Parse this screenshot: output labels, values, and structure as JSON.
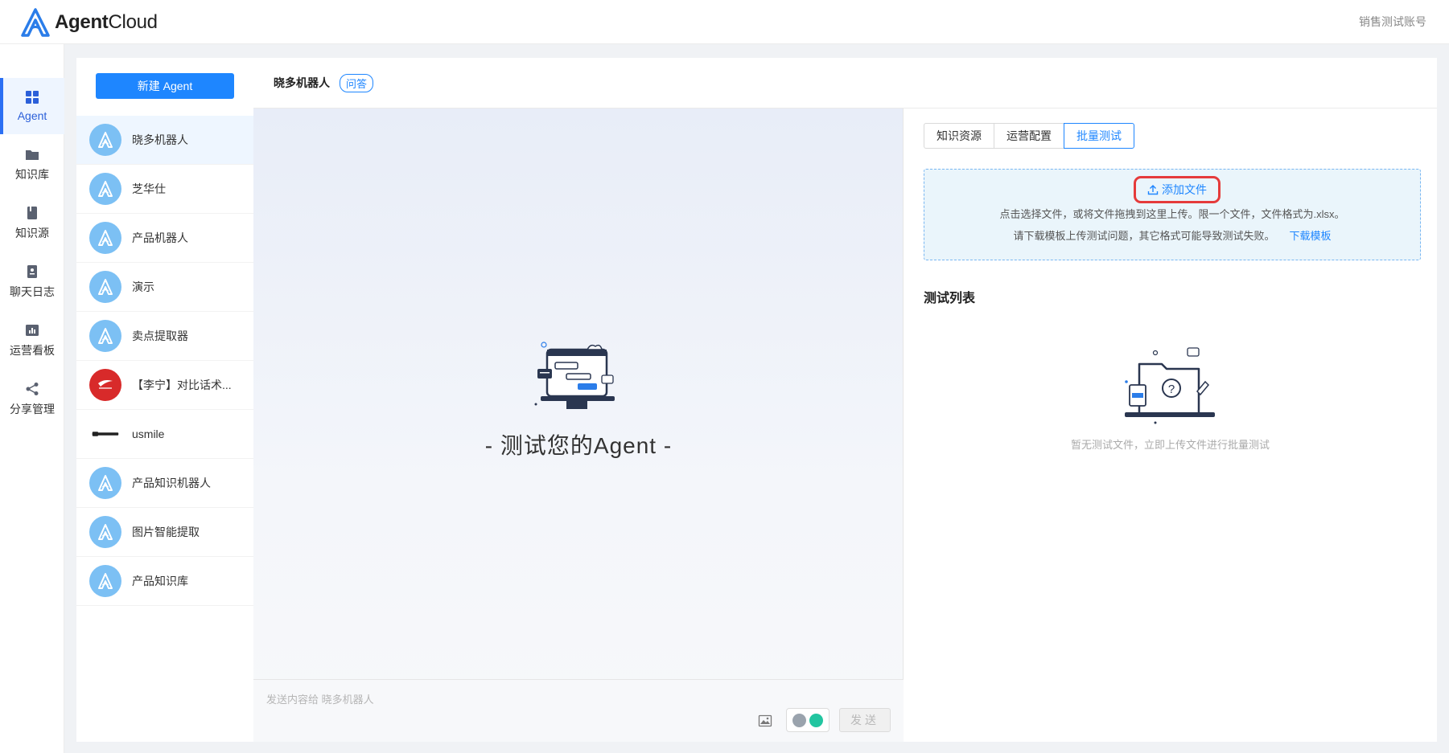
{
  "app": {
    "logo_text_bold": "Agent",
    "logo_text_light": "Cloud",
    "account": "销售测试账号"
  },
  "nav": [
    {
      "label": "Agent",
      "icon": "grid-icon",
      "active": true
    },
    {
      "label": "知识库",
      "icon": "folder-icon"
    },
    {
      "label": "知识源",
      "icon": "book-icon"
    },
    {
      "label": "聊天日志",
      "icon": "log-icon"
    },
    {
      "label": "运营看板",
      "icon": "chart-icon"
    },
    {
      "label": "分享管理",
      "icon": "share-icon"
    }
  ],
  "agent_panel": {
    "new_button": "新建 Agent",
    "agents": [
      {
        "name": "晓多机器人",
        "avatar": "agent-icon",
        "active": true
      },
      {
        "name": "芝华仕",
        "avatar": "agent-icon"
      },
      {
        "name": "产品机器人",
        "avatar": "agent-icon"
      },
      {
        "name": "演示",
        "avatar": "agent-icon"
      },
      {
        "name": "卖点提取器",
        "avatar": "agent-icon"
      },
      {
        "name": "【李宁】对比话术...",
        "avatar": "li-ning-logo"
      },
      {
        "name": "usmile",
        "avatar": "usmile-logo"
      },
      {
        "name": "产品知识机器人",
        "avatar": "agent-icon"
      },
      {
        "name": "图片智能提取",
        "avatar": "agent-icon"
      },
      {
        "name": "产品知识库",
        "avatar": "agent-icon"
      }
    ]
  },
  "header": {
    "title": "晓多机器人",
    "badge": "问答"
  },
  "chat": {
    "title": "- 测试您的Agent -",
    "input_placeholder": "发送内容给 晓多机器人",
    "send_label": "发送"
  },
  "right": {
    "tabs": [
      {
        "label": "知识资源"
      },
      {
        "label": "运营配置"
      },
      {
        "label": "批量测试",
        "active": true
      }
    ],
    "upload": {
      "add_file": "添加文件",
      "hint1": "点击选择文件，或将文件拖拽到这里上传。限一个文件，文件格式为.xlsx。",
      "hint2": "请下载模板上传测试问题，其它格式可能导致测试失败。",
      "download_link": "下载模板"
    },
    "list_title": "测试列表",
    "empty_text": "暂无测试文件，立即上传文件进行批量测试"
  },
  "colors": {
    "accent": "#1e86ff",
    "highlight": "#e53b3b",
    "avatar_bg": "#7cc0f4"
  }
}
